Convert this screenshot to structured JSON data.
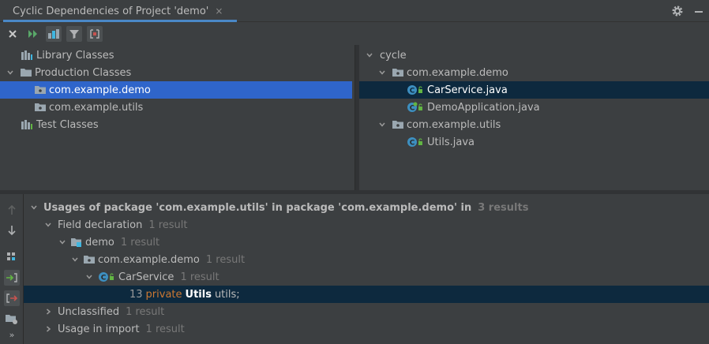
{
  "window": {
    "tab_title": "Cyclic Dependencies of Project 'demo'",
    "tab_close": "×"
  },
  "left_tree": [
    {
      "label": "Library Classes"
    },
    {
      "label": "Production Classes"
    },
    {
      "label": "com.example.demo"
    },
    {
      "label": "com.example.utils"
    },
    {
      "label": "Test Classes"
    }
  ],
  "right_tree": [
    {
      "label": "cycle"
    },
    {
      "label": "com.example.demo"
    },
    {
      "label": "CarService.java"
    },
    {
      "label": "DemoApplication.java"
    },
    {
      "label": "com.example.utils"
    },
    {
      "label": "Utils.java"
    }
  ],
  "usages": {
    "header": "Usages of package 'com.example.utils' in package 'com.example.demo' in",
    "header_count": "3 results",
    "field_declaration": "Field declaration",
    "field_declaration_count": "1 result",
    "demo": "demo",
    "demo_count": "1 result",
    "pkg": "com.example.demo",
    "pkg_count": "1 result",
    "class": "CarService",
    "class_count": "1 result",
    "code_line_no": "13",
    "code_kw": "private",
    "code_type": "Utils",
    "code_rest": "utils;",
    "unclassified": "Unclassified",
    "unclassified_count": "1 result",
    "usage_import": "Usage in import",
    "usage_import_count": "1 result"
  },
  "colors": {
    "accent": "#2f65ca",
    "selected_dark": "#0d293e",
    "class_icon": "#3d8fc0",
    "keyword": "#cc7832"
  }
}
